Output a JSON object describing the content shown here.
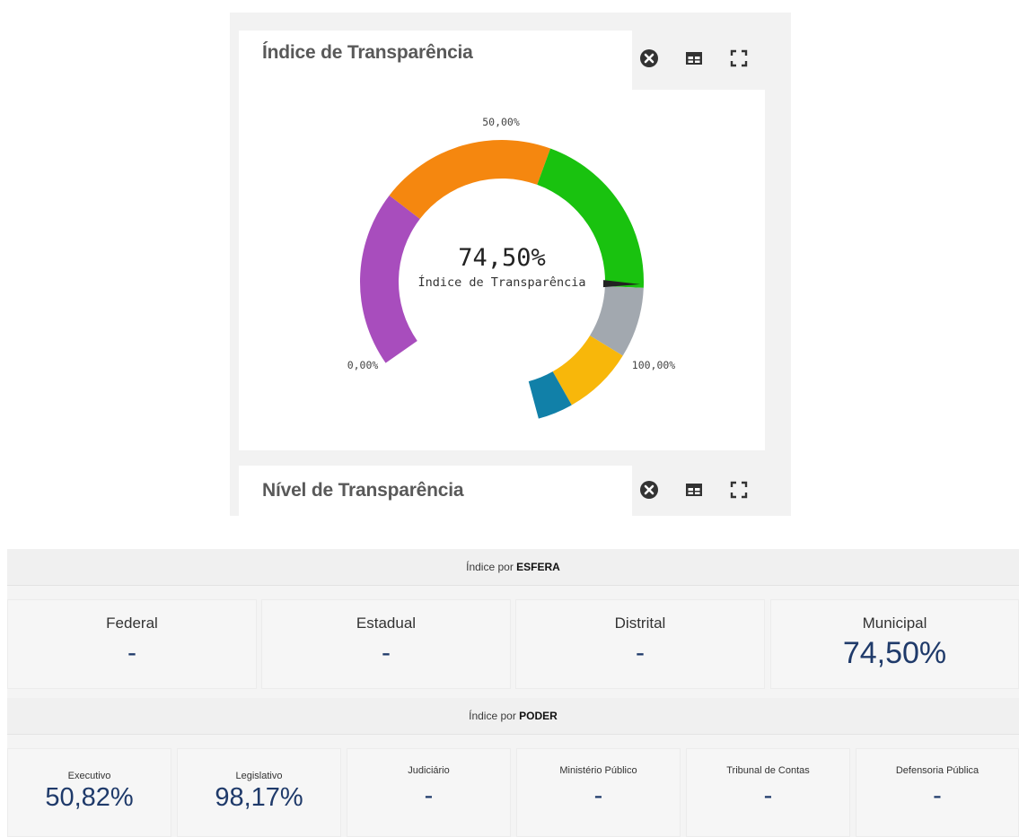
{
  "panel_indice": {
    "title": "Índice de Transparência",
    "tools": [
      "close-circle-icon",
      "table-icon",
      "fullscreen-icon"
    ]
  },
  "gauge": {
    "value_label": "74,50%",
    "caption": "Índice de Transparência",
    "min_label": "0,00%",
    "mid_label": "50,00%",
    "max_label": "100,00%",
    "value": 74.5,
    "bands": [
      {
        "from": 0,
        "to": 25,
        "color": "#a84dbd"
      },
      {
        "from": 25,
        "to": 50,
        "color": "#f5870f"
      },
      {
        "from": 50,
        "to": 75,
        "color": "#19c20f"
      },
      {
        "from": 75,
        "to": 85,
        "color": "#a2a8af"
      },
      {
        "from": 85,
        "to": 95,
        "color": "#f8b70a"
      },
      {
        "from": 95,
        "to": 100,
        "color": "#1180a8"
      }
    ]
  },
  "panel_nivel": {
    "title": "Nível de Transparência"
  },
  "esfera": {
    "band_prefix": "Índice por ",
    "band_bold": "ESFERA",
    "items": [
      {
        "label": "Federal",
        "value": "-"
      },
      {
        "label": "Estadual",
        "value": "-"
      },
      {
        "label": "Distrital",
        "value": "-"
      },
      {
        "label": "Municipal",
        "value": "74,50%"
      }
    ]
  },
  "poder": {
    "band_prefix": "Índice por ",
    "band_bold": "PODER",
    "items": [
      {
        "label": "Executivo",
        "value": "50,82%"
      },
      {
        "label": "Legislativo",
        "value": "98,17%"
      },
      {
        "label": "Judiciário",
        "value": "-"
      },
      {
        "label": "Ministério Público",
        "value": "-"
      },
      {
        "label": "Tribunal de Contas",
        "value": "-"
      },
      {
        "label": "Defensoria Pública",
        "value": "-"
      }
    ]
  }
}
